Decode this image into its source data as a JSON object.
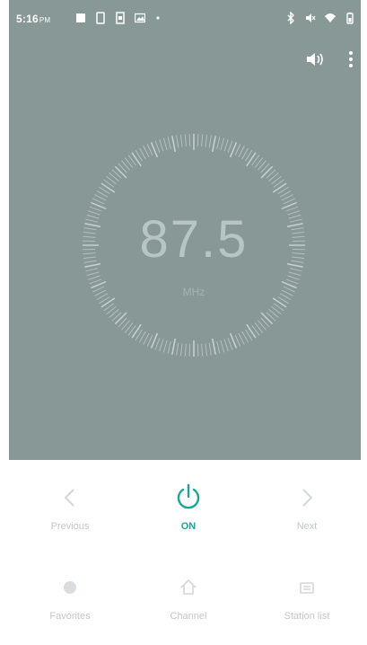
{
  "status_bar": {
    "time": "5:16",
    "ampm": "PM",
    "left_icons": [
      "sd-card-icon",
      "phone-icon",
      "sim-icon",
      "image-icon",
      "dot-icon"
    ],
    "right_icons": [
      "bluetooth-icon",
      "mute-icon",
      "wifi-icon",
      "battery-icon"
    ]
  },
  "toolbar": {
    "speaker_icon": "speaker-icon",
    "menu_icon": "overflow-menu-icon"
  },
  "dial": {
    "frequency": "87.5",
    "unit": "MHz"
  },
  "controls": {
    "previous_label": "Previous",
    "power_label": "ON",
    "next_label": "Next",
    "favorite_label": "Favorites",
    "channel_label": "Channel",
    "station_list_label": "Station list"
  },
  "colors": {
    "panel_bg": "#879896",
    "accent": "#1ea398",
    "inactive": "#c3c7c7"
  }
}
